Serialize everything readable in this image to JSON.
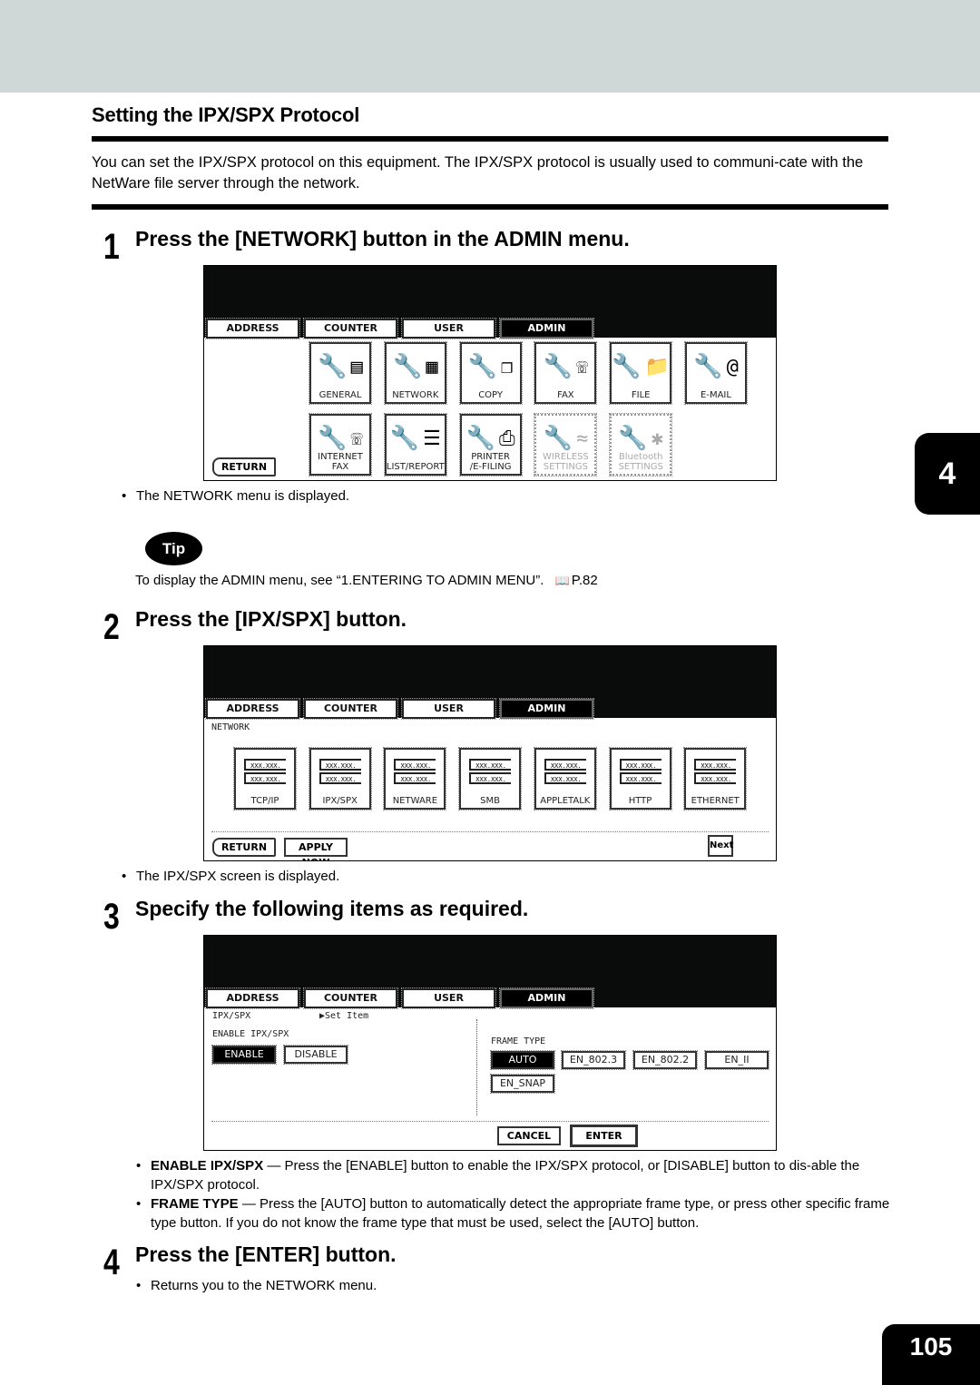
{
  "page": {
    "section_title": "Setting the IPX/SPX Protocol",
    "intro": "You can set the IPX/SPX protocol on this equipment.  The IPX/SPX protocol is usually used to communi-cate with the NetWare file server through the network.",
    "chapter_tab": "4",
    "page_number": "105"
  },
  "steps": [
    {
      "num": "1",
      "text": "Press the [NETWORK] button in the ADMIN menu.",
      "note": "The NETWORK menu is displayed."
    },
    {
      "num": "2",
      "text": "Press the [IPX/SPX] button.",
      "note": "The IPX/SPX screen is displayed."
    },
    {
      "num": "3",
      "text": "Specify the following items as required."
    },
    {
      "num": "4",
      "text": "Press the [ENTER] button.",
      "note": "Returns you to the NETWORK menu."
    }
  ],
  "tip": {
    "badge": "Tip",
    "text": "To display the ADMIN menu, see “1.ENTERING TO ADMIN MENU”.",
    "ref_icon": "book-icon",
    "ref": "P.82"
  },
  "descriptions": [
    {
      "term": "ENABLE IPX/SPX",
      "text": " — Press the [ENABLE] button to enable the IPX/SPX protocol, or [DISABLE] button to dis-able the IPX/SPX protocol."
    },
    {
      "term": "FRAME TYPE",
      "text": " — Press the [AUTO] button to automatically detect the appropriate frame type, or press other specific frame type button.  If you do not know the frame type that must be used, select the [AUTO] button."
    }
  ],
  "lcd_tabs": [
    "ADDRESS",
    "COUNTER",
    "USER",
    "ADMIN"
  ],
  "screen1": {
    "tiles_row1": [
      "GENERAL",
      "NETWORK",
      "COPY",
      "FAX",
      "FILE",
      "E-MAIL"
    ],
    "tiles_row2": [
      "INTERNET FAX",
      "LIST/REPORT",
      "PRINTER\n/E-FILING",
      "WIRELESS\nSETTINGS",
      "Bluetooth\nSETTINGS"
    ],
    "return": "RETURN"
  },
  "screen2": {
    "label": "NETWORK",
    "field_text": "XXX.XXX.",
    "tiles": [
      "TCP/IP",
      "IPX/SPX",
      "NETWARE",
      "SMB",
      "APPLETALK",
      "HTTP",
      "ETHERNET"
    ],
    "return": "RETURN",
    "apply": "APPLY NOW",
    "next": "Next"
  },
  "screen3": {
    "label": "IPX/SPX",
    "set_item": "▶Set Item",
    "enable_label": "ENABLE IPX/SPX",
    "enable": "ENABLE",
    "disable": "DISABLE",
    "frame_label": "FRAME TYPE",
    "frames": [
      "AUTO",
      "EN_802.3",
      "EN_802.2",
      "EN_II",
      "EN_SNAP"
    ],
    "selected_frame": "AUTO",
    "selected_enable": "ENABLE",
    "cancel": "CANCEL",
    "enter": "ENTER"
  }
}
